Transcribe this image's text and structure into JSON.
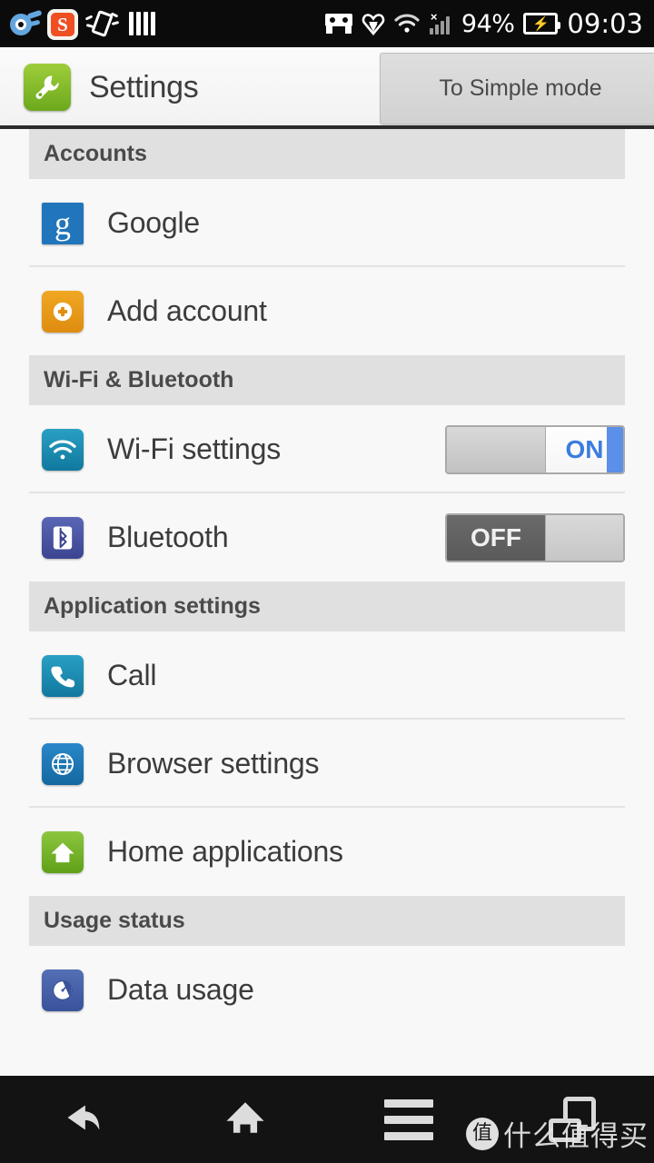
{
  "status_bar": {
    "notification_icons": [
      "comet-icon",
      "sogou-icon",
      "shake-phone-icon",
      "bars-icon"
    ],
    "sogou_letter": "S",
    "system_icons": [
      "goggles-icon",
      "heart-icon",
      "wifi-icon",
      "cellular-signal-icon"
    ],
    "signal_x": "×",
    "battery_percent": "94%",
    "battery_charging_glyph": "⚡",
    "clock": "09:03"
  },
  "header": {
    "app_icon": "wrench-icon",
    "title": "Settings",
    "simple_mode_button": "To Simple mode"
  },
  "sections": [
    {
      "title": "Accounts",
      "items": [
        {
          "label": "Google",
          "icon": "google-icon",
          "glyph": "g",
          "toggle": null
        },
        {
          "label": "Add account",
          "icon": "add-account-icon",
          "toggle": null
        }
      ]
    },
    {
      "title": "Wi-Fi & Bluetooth",
      "items": [
        {
          "label": "Wi-Fi settings",
          "icon": "wifi-icon",
          "toggle": {
            "state": "on",
            "on_label": "ON",
            "off_label": ""
          }
        },
        {
          "label": "Bluetooth",
          "icon": "bluetooth-icon",
          "toggle": {
            "state": "off",
            "on_label": "",
            "off_label": "OFF"
          }
        }
      ]
    },
    {
      "title": "Application settings",
      "items": [
        {
          "label": "Call",
          "icon": "phone-icon",
          "toggle": null
        },
        {
          "label": "Browser settings",
          "icon": "globe-icon",
          "toggle": null
        },
        {
          "label": "Home applications",
          "icon": "home-icon",
          "toggle": null
        }
      ]
    },
    {
      "title": "Usage status",
      "items": [
        {
          "label": "Data usage",
          "icon": "data-usage-icon",
          "toggle": null
        }
      ]
    }
  ],
  "navbar": {
    "buttons": [
      "back-icon",
      "home-icon",
      "menu-icon",
      "recent-apps-icon"
    ]
  },
  "watermark": {
    "badge": "值",
    "text": "什么值得买"
  },
  "colors": {
    "accent_blue": "#5b8fe8",
    "on_text_blue": "#3b7de0",
    "section_header_bg": "#e0e0e0",
    "list_bg": "#f8f8f8",
    "statusbar_bg": "#0b0b0b",
    "navbar_bg": "#131313"
  }
}
